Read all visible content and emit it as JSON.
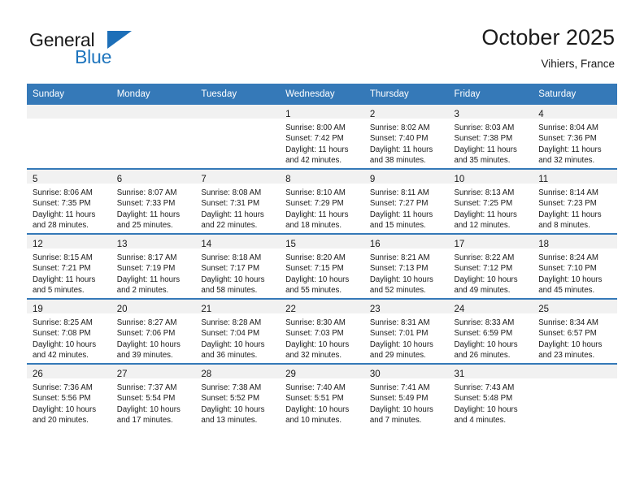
{
  "brand": {
    "name_part1": "General",
    "name_part2": "Blue",
    "triangle_color": "#1d6fb8",
    "text_color": "#1a1a1a",
    "blue_color": "#1d74bd"
  },
  "header": {
    "title": "October 2025",
    "location": "Vihiers, France"
  },
  "calendar": {
    "header_bg": "#3579b8",
    "daynum_bg": "#f1f1f1",
    "weekday_headers": [
      "Sunday",
      "Monday",
      "Tuesday",
      "Wednesday",
      "Thursday",
      "Friday",
      "Saturday"
    ],
    "weeks": [
      [
        {
          "day": "",
          "lines": []
        },
        {
          "day": "",
          "lines": []
        },
        {
          "day": "",
          "lines": []
        },
        {
          "day": "1",
          "lines": [
            "Sunrise: 8:00 AM",
            "Sunset: 7:42 PM",
            "Daylight: 11 hours",
            "and 42 minutes."
          ]
        },
        {
          "day": "2",
          "lines": [
            "Sunrise: 8:02 AM",
            "Sunset: 7:40 PM",
            "Daylight: 11 hours",
            "and 38 minutes."
          ]
        },
        {
          "day": "3",
          "lines": [
            "Sunrise: 8:03 AM",
            "Sunset: 7:38 PM",
            "Daylight: 11 hours",
            "and 35 minutes."
          ]
        },
        {
          "day": "4",
          "lines": [
            "Sunrise: 8:04 AM",
            "Sunset: 7:36 PM",
            "Daylight: 11 hours",
            "and 32 minutes."
          ]
        }
      ],
      [
        {
          "day": "5",
          "lines": [
            "Sunrise: 8:06 AM",
            "Sunset: 7:35 PM",
            "Daylight: 11 hours",
            "and 28 minutes."
          ]
        },
        {
          "day": "6",
          "lines": [
            "Sunrise: 8:07 AM",
            "Sunset: 7:33 PM",
            "Daylight: 11 hours",
            "and 25 minutes."
          ]
        },
        {
          "day": "7",
          "lines": [
            "Sunrise: 8:08 AM",
            "Sunset: 7:31 PM",
            "Daylight: 11 hours",
            "and 22 minutes."
          ]
        },
        {
          "day": "8",
          "lines": [
            "Sunrise: 8:10 AM",
            "Sunset: 7:29 PM",
            "Daylight: 11 hours",
            "and 18 minutes."
          ]
        },
        {
          "day": "9",
          "lines": [
            "Sunrise: 8:11 AM",
            "Sunset: 7:27 PM",
            "Daylight: 11 hours",
            "and 15 minutes."
          ]
        },
        {
          "day": "10",
          "lines": [
            "Sunrise: 8:13 AM",
            "Sunset: 7:25 PM",
            "Daylight: 11 hours",
            "and 12 minutes."
          ]
        },
        {
          "day": "11",
          "lines": [
            "Sunrise: 8:14 AM",
            "Sunset: 7:23 PM",
            "Daylight: 11 hours",
            "and 8 minutes."
          ]
        }
      ],
      [
        {
          "day": "12",
          "lines": [
            "Sunrise: 8:15 AM",
            "Sunset: 7:21 PM",
            "Daylight: 11 hours",
            "and 5 minutes."
          ]
        },
        {
          "day": "13",
          "lines": [
            "Sunrise: 8:17 AM",
            "Sunset: 7:19 PM",
            "Daylight: 11 hours",
            "and 2 minutes."
          ]
        },
        {
          "day": "14",
          "lines": [
            "Sunrise: 8:18 AM",
            "Sunset: 7:17 PM",
            "Daylight: 10 hours",
            "and 58 minutes."
          ]
        },
        {
          "day": "15",
          "lines": [
            "Sunrise: 8:20 AM",
            "Sunset: 7:15 PM",
            "Daylight: 10 hours",
            "and 55 minutes."
          ]
        },
        {
          "day": "16",
          "lines": [
            "Sunrise: 8:21 AM",
            "Sunset: 7:13 PM",
            "Daylight: 10 hours",
            "and 52 minutes."
          ]
        },
        {
          "day": "17",
          "lines": [
            "Sunrise: 8:22 AM",
            "Sunset: 7:12 PM",
            "Daylight: 10 hours",
            "and 49 minutes."
          ]
        },
        {
          "day": "18",
          "lines": [
            "Sunrise: 8:24 AM",
            "Sunset: 7:10 PM",
            "Daylight: 10 hours",
            "and 45 minutes."
          ]
        }
      ],
      [
        {
          "day": "19",
          "lines": [
            "Sunrise: 8:25 AM",
            "Sunset: 7:08 PM",
            "Daylight: 10 hours",
            "and 42 minutes."
          ]
        },
        {
          "day": "20",
          "lines": [
            "Sunrise: 8:27 AM",
            "Sunset: 7:06 PM",
            "Daylight: 10 hours",
            "and 39 minutes."
          ]
        },
        {
          "day": "21",
          "lines": [
            "Sunrise: 8:28 AM",
            "Sunset: 7:04 PM",
            "Daylight: 10 hours",
            "and 36 minutes."
          ]
        },
        {
          "day": "22",
          "lines": [
            "Sunrise: 8:30 AM",
            "Sunset: 7:03 PM",
            "Daylight: 10 hours",
            "and 32 minutes."
          ]
        },
        {
          "day": "23",
          "lines": [
            "Sunrise: 8:31 AM",
            "Sunset: 7:01 PM",
            "Daylight: 10 hours",
            "and 29 minutes."
          ]
        },
        {
          "day": "24",
          "lines": [
            "Sunrise: 8:33 AM",
            "Sunset: 6:59 PM",
            "Daylight: 10 hours",
            "and 26 minutes."
          ]
        },
        {
          "day": "25",
          "lines": [
            "Sunrise: 8:34 AM",
            "Sunset: 6:57 PM",
            "Daylight: 10 hours",
            "and 23 minutes."
          ]
        }
      ],
      [
        {
          "day": "26",
          "lines": [
            "Sunrise: 7:36 AM",
            "Sunset: 5:56 PM",
            "Daylight: 10 hours",
            "and 20 minutes."
          ]
        },
        {
          "day": "27",
          "lines": [
            "Sunrise: 7:37 AM",
            "Sunset: 5:54 PM",
            "Daylight: 10 hours",
            "and 17 minutes."
          ]
        },
        {
          "day": "28",
          "lines": [
            "Sunrise: 7:38 AM",
            "Sunset: 5:52 PM",
            "Daylight: 10 hours",
            "and 13 minutes."
          ]
        },
        {
          "day": "29",
          "lines": [
            "Sunrise: 7:40 AM",
            "Sunset: 5:51 PM",
            "Daylight: 10 hours",
            "and 10 minutes."
          ]
        },
        {
          "day": "30",
          "lines": [
            "Sunrise: 7:41 AM",
            "Sunset: 5:49 PM",
            "Daylight: 10 hours",
            "and 7 minutes."
          ]
        },
        {
          "day": "31",
          "lines": [
            "Sunrise: 7:43 AM",
            "Sunset: 5:48 PM",
            "Daylight: 10 hours",
            "and 4 minutes."
          ]
        },
        {
          "day": "",
          "lines": []
        }
      ]
    ]
  }
}
